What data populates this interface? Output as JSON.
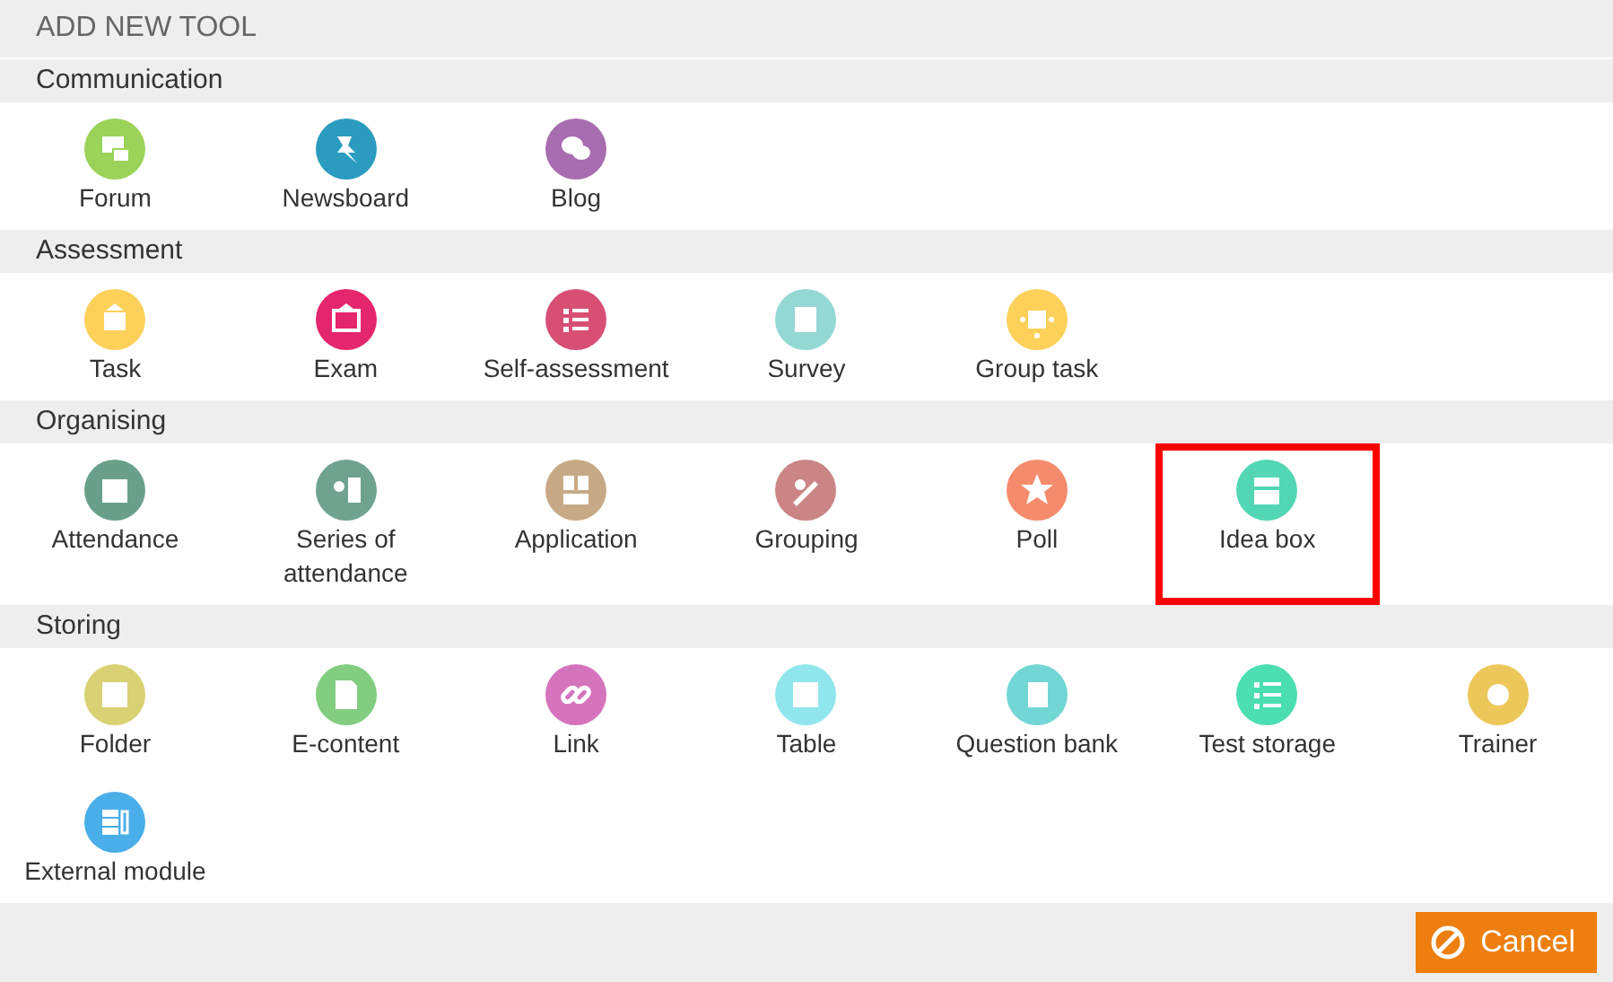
{
  "dialog": {
    "title": "ADD NEW TOOL"
  },
  "sections": [
    {
      "title": "Communication",
      "tools": [
        {
          "label": "Forum",
          "color": "#9bd35a",
          "highlighted": false
        },
        {
          "label": "Newsboard",
          "color": "#2b9cc0",
          "highlighted": false
        },
        {
          "label": "Blog",
          "color": "#a86cb0",
          "highlighted": false
        }
      ]
    },
    {
      "title": "Assessment",
      "tools": [
        {
          "label": "Task",
          "color": "#fdd05a",
          "highlighted": false
        },
        {
          "label": "Exam",
          "color": "#e4266c",
          "highlighted": false
        },
        {
          "label": "Self-assessment",
          "color": "#d84f74",
          "highlighted": false
        },
        {
          "label": "Survey",
          "color": "#93d8d2",
          "highlighted": false
        },
        {
          "label": "Group task",
          "color": "#fdd05a",
          "highlighted": false
        }
      ]
    },
    {
      "title": "Organising",
      "tools": [
        {
          "label": "Attendance",
          "color": "#6aa08a",
          "highlighted": false
        },
        {
          "label": "Series of attendance",
          "color": "#6fa390",
          "highlighted": false
        },
        {
          "label": "Application",
          "color": "#c7aa85",
          "highlighted": false
        },
        {
          "label": "Grouping",
          "color": "#cb8585",
          "highlighted": false
        },
        {
          "label": "Poll",
          "color": "#f58b6d",
          "highlighted": false
        },
        {
          "label": "Idea box",
          "color": "#52d6b3",
          "highlighted": true
        }
      ]
    },
    {
      "title": "Storing",
      "tools": [
        {
          "label": "Folder",
          "color": "#d9d173",
          "highlighted": false
        },
        {
          "label": "E-content",
          "color": "#82cd80",
          "highlighted": false
        },
        {
          "label": "Link",
          "color": "#d573bd",
          "highlighted": false
        },
        {
          "label": "Table",
          "color": "#90e6ec",
          "highlighted": false
        },
        {
          "label": "Question bank",
          "color": "#72d6d4",
          "highlighted": false
        },
        {
          "label": "Test storage",
          "color": "#4bdeb0",
          "highlighted": false
        },
        {
          "label": "Trainer",
          "color": "#ecc85a",
          "highlighted": false
        },
        {
          "label": "External module",
          "color": "#4aaee9",
          "highlighted": false
        }
      ]
    }
  ],
  "cancel_button": {
    "label": "Cancel"
  }
}
